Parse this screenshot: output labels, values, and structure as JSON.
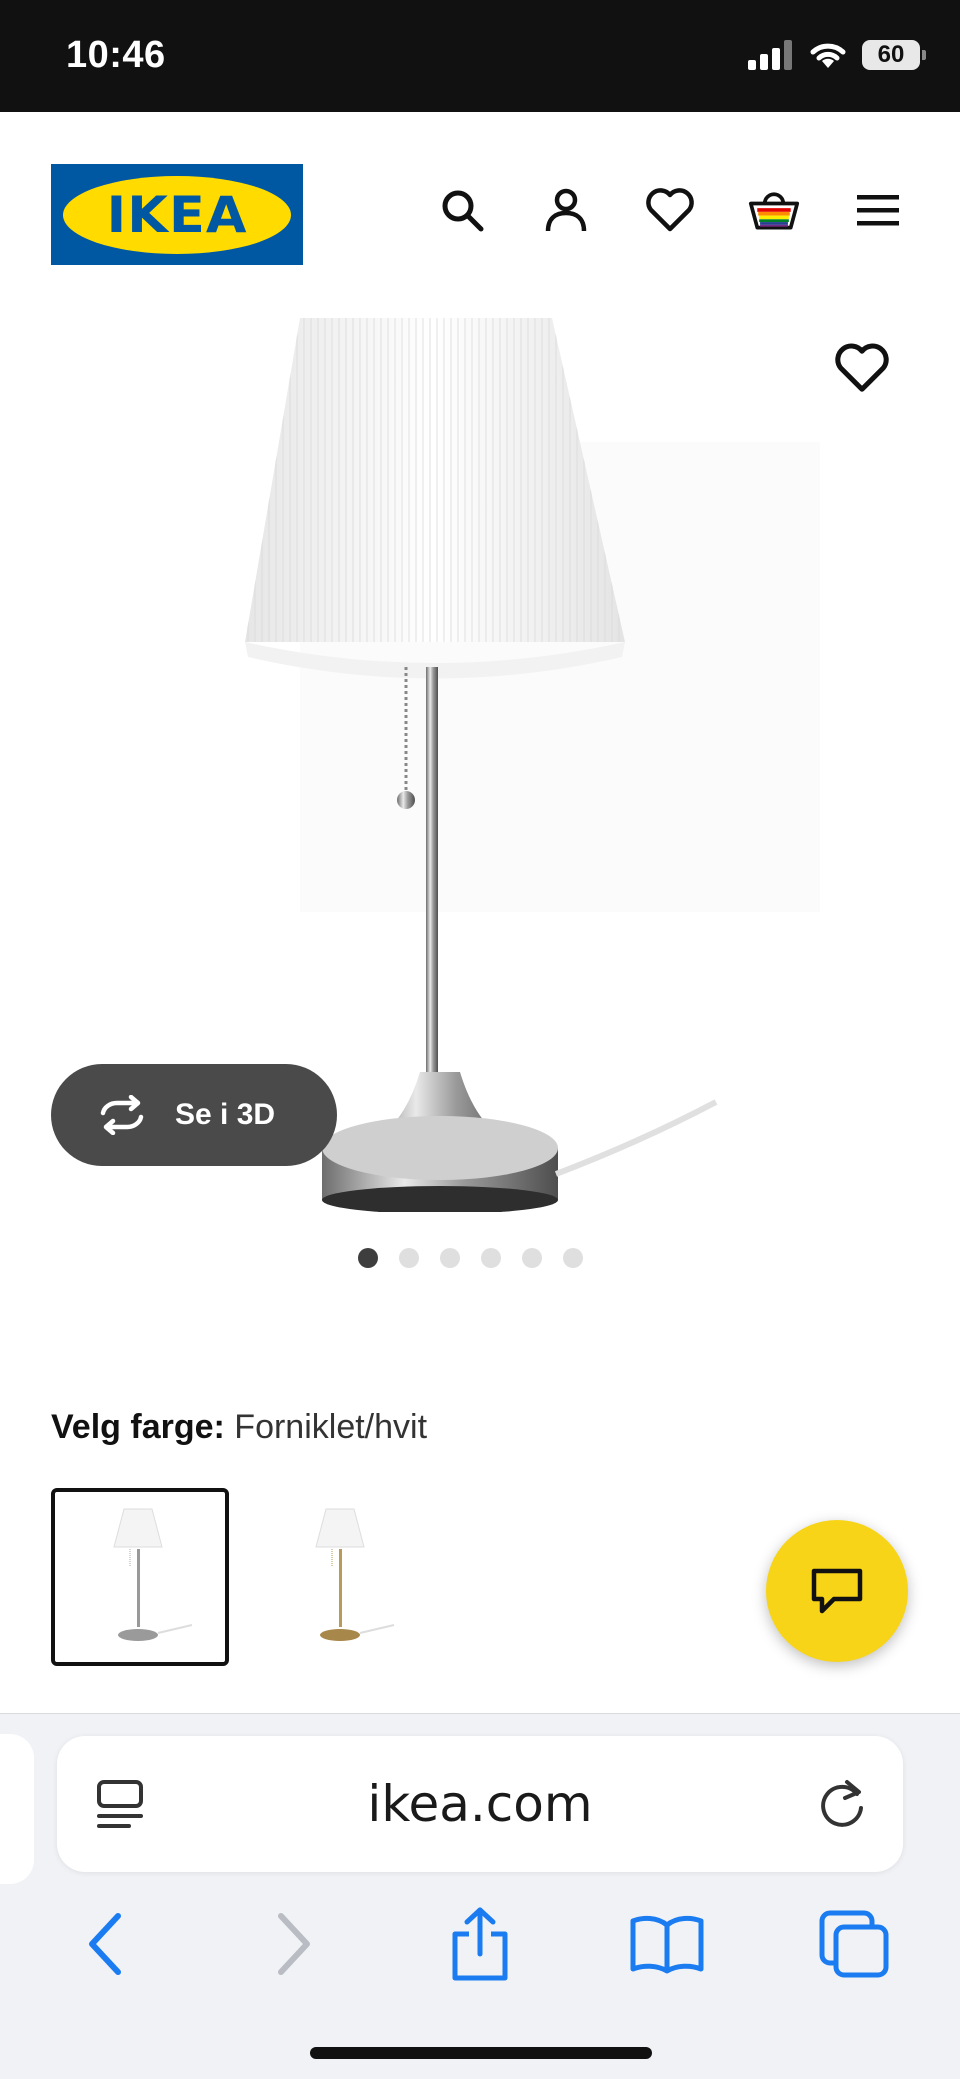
{
  "status_bar": {
    "time": "10:46",
    "battery": "60",
    "icons": [
      "signal-icon",
      "wifi-icon",
      "battery-icon"
    ]
  },
  "header": {
    "logo_text": "IKEA",
    "icons": [
      "search-icon",
      "account-icon",
      "wishlist-icon",
      "cart-icon",
      "menu-icon"
    ]
  },
  "product": {
    "view_3d_label": "Se i 3D",
    "carousel": {
      "total": 6,
      "active": 1
    },
    "color_label": "Velg farge:",
    "color_value": "Forniklet/hvit",
    "swatches": [
      "nickel-white",
      "brass-white"
    ]
  },
  "browser": {
    "url": "ikea.com",
    "nav": [
      "back-icon",
      "forward-icon",
      "share-icon",
      "bookmarks-icon",
      "tabs-icon"
    ]
  },
  "colors": {
    "ikea_blue": "#0058a3",
    "ikea_yellow": "#ffdb00",
    "chat_yellow": "#f7d417",
    "safari_blue": "#1a7cf0"
  }
}
